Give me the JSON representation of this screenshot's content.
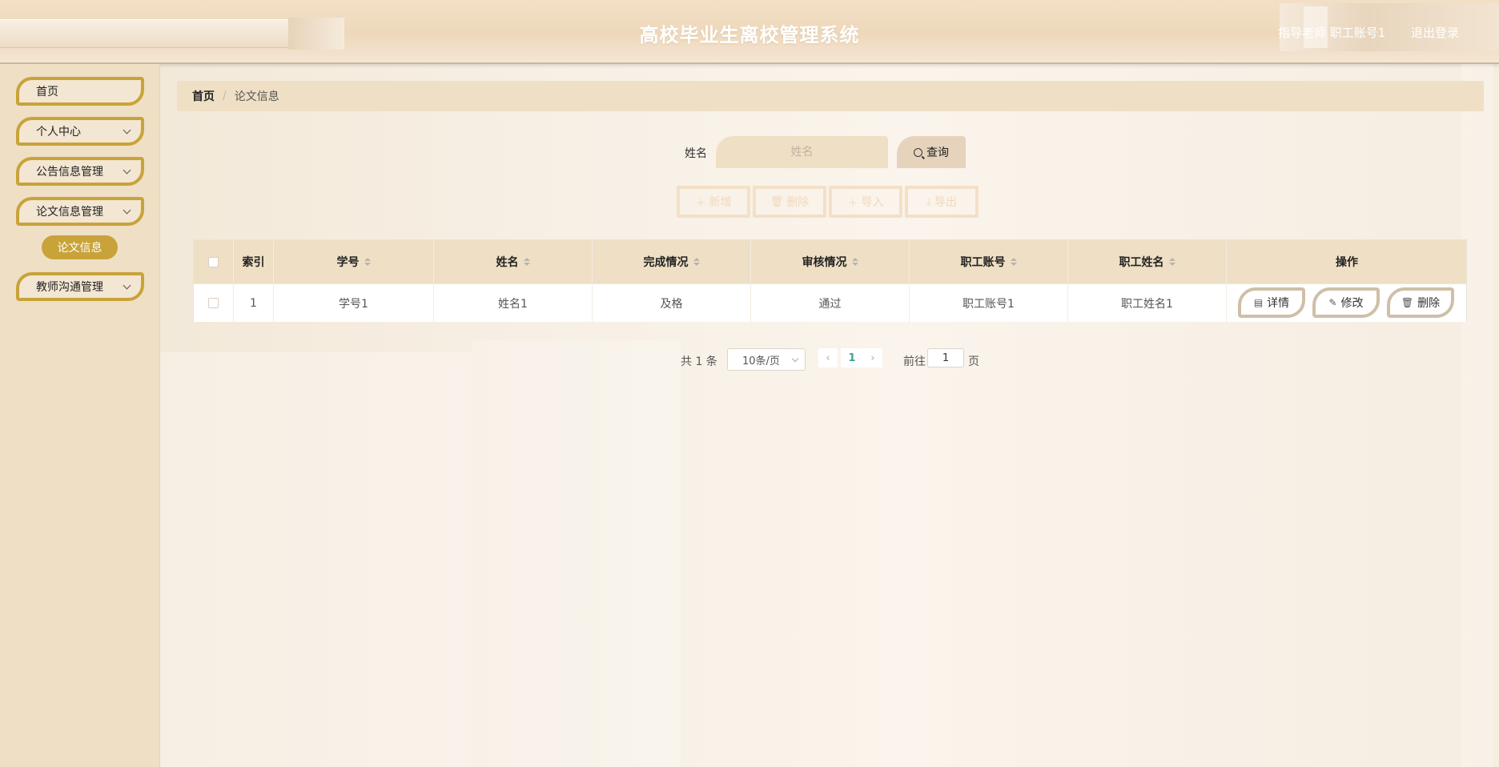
{
  "header": {
    "title": "高校毕业生离校管理系统",
    "user_info": "指导老师 职工账号1",
    "logout": "退出登录"
  },
  "sidebar": {
    "items": [
      {
        "label": "首页",
        "expandable": false
      },
      {
        "label": "个人中心",
        "expandable": true
      },
      {
        "label": "公告信息管理",
        "expandable": true
      },
      {
        "label": "论文信息管理",
        "expandable": true,
        "expanded": true
      },
      {
        "label": "教师沟通管理",
        "expandable": true
      }
    ],
    "active_sub_item": "论文信息"
  },
  "breadcrumb": {
    "home": "首页",
    "separator": "/",
    "current": "论文信息"
  },
  "search": {
    "label": "姓名",
    "placeholder": "姓名",
    "value": "",
    "button_label": "查询",
    "button_icon": "search-icon"
  },
  "toolbar": {
    "add_label": "新增",
    "delete_label": "删除",
    "import_label": "导入",
    "export_label": "导出",
    "state": "disabled"
  },
  "table": {
    "columns": [
      "索引",
      "学号",
      "姓名",
      "完成情况",
      "审核情况",
      "职工账号",
      "职工姓名",
      "操作"
    ],
    "sortable": [
      "学号",
      "姓名",
      "完成情况",
      "审核情况",
      "职工账号",
      "职工姓名"
    ],
    "rows": [
      {
        "index": "1",
        "student_no": "学号1",
        "name": "姓名1",
        "completion": "及格",
        "review": "通过",
        "staff_account": "职工账号1",
        "staff_name": "职工姓名1"
      }
    ],
    "actions": {
      "detail": "详情",
      "edit": "修改",
      "delete": "删除"
    }
  },
  "pagination": {
    "total_text": "共 1 条",
    "page_size": "10条/页",
    "current_page": "1",
    "goto_label": "前往",
    "goto_value": "1",
    "goto_suffix": "页"
  },
  "colors": {
    "accent_gold": "#c8a339",
    "panel_beige": "#efdfc4",
    "active_page": "#3fa38f"
  }
}
